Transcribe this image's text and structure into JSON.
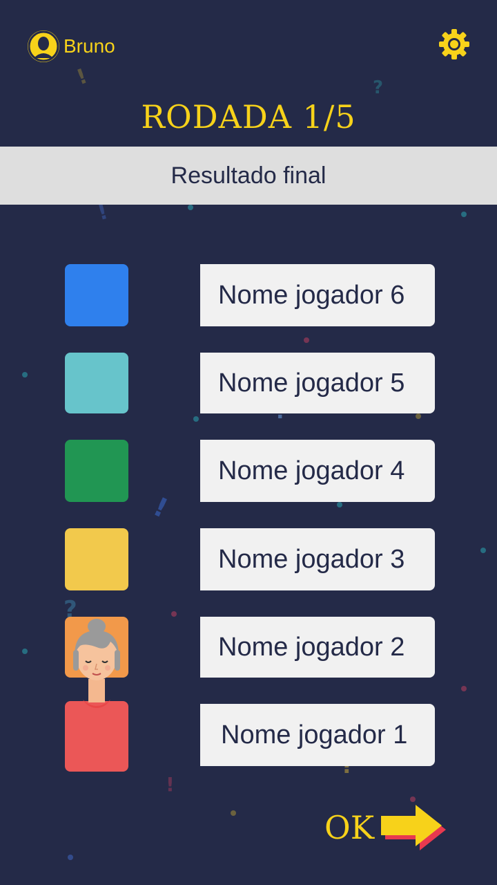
{
  "header": {
    "username": "Bruno",
    "avatar_icon": "user-avatar-icon",
    "settings_icon": "gear-icon",
    "accent_color": "#f7d21a"
  },
  "round": {
    "title": "RODADA 1/5"
  },
  "result": {
    "label": "Resultado final"
  },
  "players": [
    {
      "name": "Nome jogador 6",
      "color": "#2f80ed"
    },
    {
      "name": "Nome jogador 5",
      "color": "#67c4cb"
    },
    {
      "name": "Nome jogador 4",
      "color": "#219653"
    },
    {
      "name": "Nome jogador 3",
      "color": "#f2c94c"
    },
    {
      "name": "Nome jogador 2",
      "color": "#f2994a"
    },
    {
      "name": "Nome jogador 1",
      "color": "#eb5757"
    }
  ],
  "footer": {
    "ok_label": "OK",
    "arrow_icon": "arrow-right-icon"
  },
  "colors": {
    "background": "#242a48",
    "row_bg": "#f1f1f1",
    "result_bar": "#dedede"
  }
}
